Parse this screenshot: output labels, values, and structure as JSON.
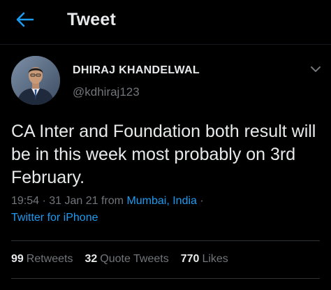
{
  "header": {
    "title": "Tweet",
    "back_icon": "arrow-left-icon"
  },
  "author": {
    "name": "DHIRAJ KHANDELWAL",
    "handle": "@kdhiraj123",
    "more_icon": "chevron-down-icon"
  },
  "tweet": {
    "text": "CA Inter and Foundation both result will be in this week most probably on 3rd February.",
    "time": "19:54",
    "sep1": " · ",
    "date": "31 Jan 21",
    "from_word": " from ",
    "location": "Mumbai, India",
    "sep2": " ·",
    "source": "Twitter for iPhone"
  },
  "stats": [
    {
      "count": "99",
      "label": "Retweets"
    },
    {
      "count": "32",
      "label": "Quote Tweets"
    },
    {
      "count": "770",
      "label": "Likes"
    }
  ],
  "colors": {
    "background": "#000000",
    "accent": "#1d9bf0",
    "primary_text": "#e7e9ea",
    "secondary_text": "#71767b",
    "divider": "#2f3336"
  }
}
